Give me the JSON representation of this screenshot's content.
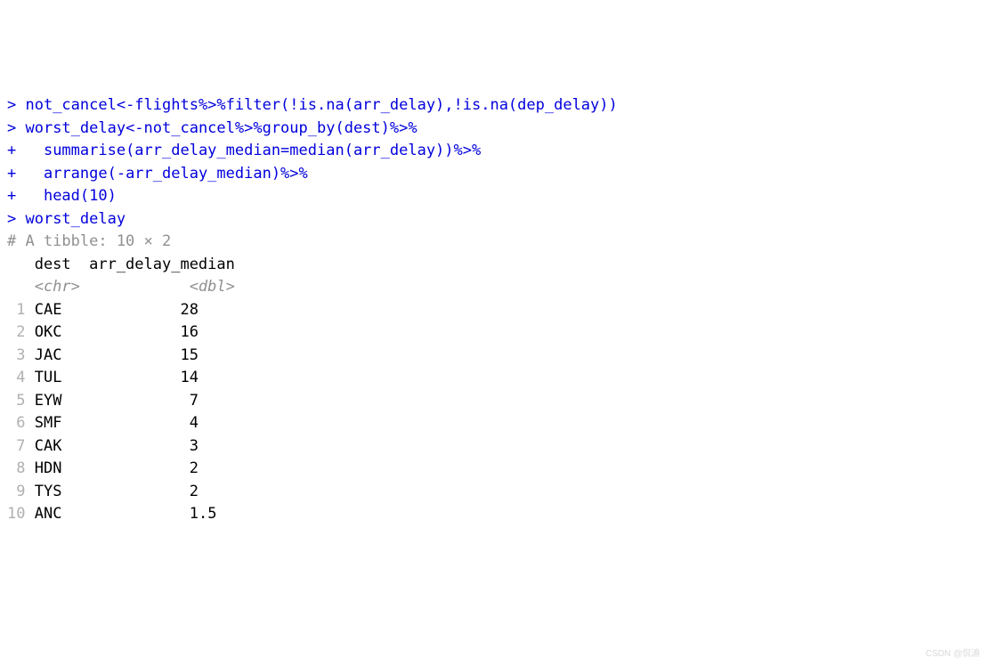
{
  "console": {
    "lines": [
      {
        "prompt": ">",
        "code": "not_cancel<-flights%>%filter(!is.na(arr_delay),!is.na(dep_delay))"
      },
      {
        "prompt": ">",
        "code": "worst_delay<-not_cancel%>%group_by(dest)%>%"
      },
      {
        "prompt": "+",
        "code": "  summarise(arr_delay_median=median(arr_delay))%>%"
      },
      {
        "prompt": "+",
        "code": "  arrange(-arr_delay_median)%>%"
      },
      {
        "prompt": "+",
        "code": "  head(10)"
      },
      {
        "prompt": ">",
        "code": "worst_delay"
      }
    ],
    "tibble_header": "# A tibble: 10 × 2",
    "col_header": "   dest  arr_delay_median",
    "type_header": "   <chr>            <dbl>",
    "rows": [
      {
        "n": " 1",
        "dest": "CAE",
        "val": "28  "
      },
      {
        "n": " 2",
        "dest": "OKC",
        "val": "16  "
      },
      {
        "n": " 3",
        "dest": "JAC",
        "val": "15  "
      },
      {
        "n": " 4",
        "dest": "TUL",
        "val": "14  "
      },
      {
        "n": " 5",
        "dest": "EYW",
        "val": " 7  "
      },
      {
        "n": " 6",
        "dest": "SMF",
        "val": " 4  "
      },
      {
        "n": " 7",
        "dest": "CAK",
        "val": " 3  "
      },
      {
        "n": " 8",
        "dest": "HDN",
        "val": " 2  "
      },
      {
        "n": " 9",
        "dest": "TYS",
        "val": " 2  "
      },
      {
        "n": "10",
        "dest": "ANC",
        "val": " 1.5"
      }
    ]
  },
  "watermark": "CSDN @侃渝"
}
